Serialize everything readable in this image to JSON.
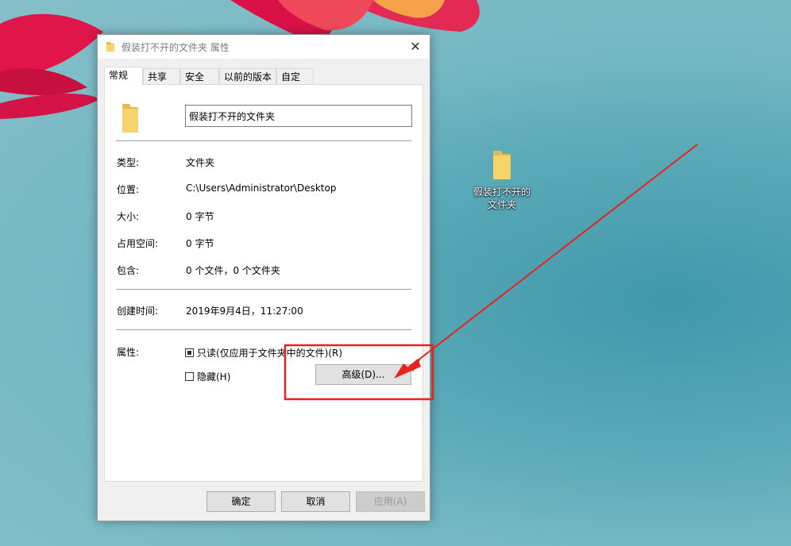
{
  "desktop": {
    "folder_label_line1": "假装打不开的",
    "folder_label_line2": "文件夹"
  },
  "dialog": {
    "title": "假装打不开的文件夹 属性",
    "close_glyph": "✕",
    "tabs": [
      {
        "label": "常规"
      },
      {
        "label": "共享"
      },
      {
        "label": "安全"
      },
      {
        "label": "以前的版本"
      },
      {
        "label": "自定义"
      }
    ],
    "active_tab": "常规",
    "folder_name": "假装打不开的文件夹",
    "properties": [
      {
        "label": "类型:",
        "value": "文件夹"
      },
      {
        "label": "位置:",
        "value": "C:\\Users\\Administrator\\Desktop"
      },
      {
        "label": "大小:",
        "value": "0 字节"
      },
      {
        "label": "占用空间:",
        "value": "0 字节"
      },
      {
        "label": "包含:",
        "value": "0 个文件，0 个文件夹"
      }
    ],
    "created": {
      "label": "创建时间:",
      "value": "2019年9月4日，11:27:00"
    },
    "attributes": {
      "label": "属性:",
      "readonly_label": "只读(仅应用于文件夹中的文件)(R)",
      "readonly_checked": true,
      "hidden_label": "隐藏(H)",
      "hidden_checked": false,
      "advanced_button": "高级(D)..."
    },
    "buttons": {
      "ok": "确定",
      "cancel": "取消",
      "apply": "应用(A)"
    }
  },
  "annotation": {
    "color": "#e8231f"
  }
}
